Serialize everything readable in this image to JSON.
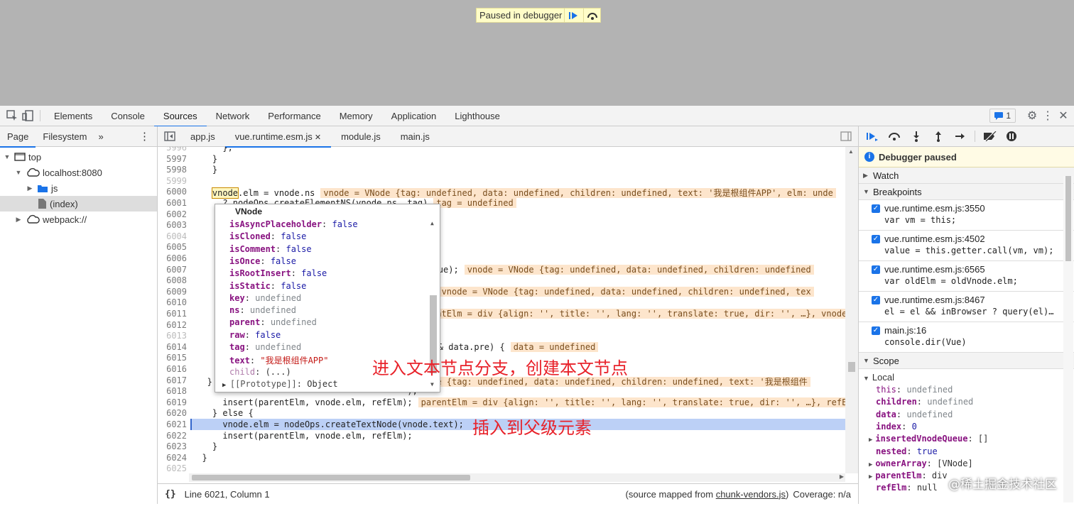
{
  "banner": {
    "text": "Paused in debugger"
  },
  "toolbar": {
    "tabs": [
      "Elements",
      "Console",
      "Sources",
      "Network",
      "Performance",
      "Memory",
      "Application",
      "Lighthouse"
    ],
    "active_tab": "Sources",
    "issues_count": "1"
  },
  "navigator": {
    "tabs": [
      "Page",
      "Filesystem"
    ],
    "tree": [
      {
        "label": "top",
        "depth": 0,
        "arrow": "▼",
        "icon": "frame-icon"
      },
      {
        "label": "localhost:8080",
        "depth": 1,
        "arrow": "▼",
        "icon": "cloud-icon"
      },
      {
        "label": "js",
        "depth": 2,
        "arrow": "▶",
        "icon": "folder-icon"
      },
      {
        "label": "(index)",
        "depth": 2,
        "arrow": "",
        "icon": "file-icon"
      },
      {
        "label": "webpack://",
        "depth": 1,
        "arrow": "▶",
        "icon": "cloud-icon"
      }
    ]
  },
  "editor": {
    "file_tabs": [
      "app.js",
      "vue.runtime.esm.js",
      "module.js",
      "main.js"
    ],
    "active_file": "vue.runtime.esm.js",
    "lines": [
      {
        "n": "5996",
        "dim": true,
        "code": "      },"
      },
      {
        "n": "5997",
        "dim": false,
        "code": "    }"
      },
      {
        "n": "5998",
        "dim": false,
        "code": "    }"
      },
      {
        "n": "5999",
        "dim": true,
        "code": ""
      },
      {
        "n": "6000",
        "dim": false,
        "code": "    vnode.elm = vnode.ns",
        "inline": "vnode = VNode {tag: undefined, data: undefined, children: undefined, text: '我是根组件APP', elm: unde"
      },
      {
        "n": "6001",
        "dim": false,
        "code": "      ? nodeOps.createElementNS(vnode.ns, tag)",
        "inline": "tag = undefined"
      },
      {
        "n": "6002",
        "dim": false,
        "code": ""
      },
      {
        "n": "6003",
        "dim": false,
        "code": ""
      },
      {
        "n": "6004",
        "dim": true,
        "code": ""
      },
      {
        "n": "6005",
        "dim": false,
        "code": ""
      },
      {
        "n": "6006",
        "dim": false,
        "code": ""
      },
      {
        "n": "6007",
        "dim": false,
        "code": "                                          odeQueue);",
        "inline": "vnode = VNode {tag: undefined, data: undefined, children: undefined"
      },
      {
        "n": "6008",
        "dim": false,
        "code": ""
      },
      {
        "n": "6009",
        "dim": false,
        "code": "                                          eue);",
        "inline": "vnode = VNode {tag: undefined, data: undefined, children: undefined, tex"
      },
      {
        "n": "6010",
        "dim": false,
        "code": ""
      },
      {
        "n": "6011",
        "dim": false,
        "code": "                                          ",
        "inline": "parentElm = div {align: '', title: '', lang: '', translate: true, dir: '', …}, vnode"
      },
      {
        "n": "6012",
        "dim": false,
        "code": ""
      },
      {
        "n": "6013",
        "dim": true,
        "code": ""
      },
      {
        "n": "6014",
        "dim": false,
        "code": "                                          data && data.pre) {",
        "inline": "data = undefined"
      },
      {
        "n": "6015",
        "dim": false,
        "code": ""
      },
      {
        "n": "6016",
        "dim": false,
        "code": ""
      },
      {
        "n": "6017",
        "dim": false,
        "code": "   }                                      ",
        "inline": "VNode {tag: undefined, data: undefined, children: undefined, text: '我是根组件"
      },
      {
        "n": "6018",
        "dim": false,
        "code": "                                          );"
      },
      {
        "n": "6019",
        "dim": false,
        "code": "      insert(parentElm, vnode.elm, refElm);",
        "inline": "parentElm = div {align: '', title: '', lang: '', translate: true, dir: '', …}, refElm"
      },
      {
        "n": "6020",
        "dim": false,
        "code": "    } else {"
      },
      {
        "n": "6021",
        "dim": false,
        "code": "      vnode.elm = nodeOps.createTextNode(vnode.text);"
      },
      {
        "n": "6022",
        "dim": false,
        "code": "      insert(parentElm, vnode.elm, refElm);"
      },
      {
        "n": "6023",
        "dim": false,
        "code": "    }"
      },
      {
        "n": "6024",
        "dim": false,
        "code": "  }"
      },
      {
        "n": "6025",
        "dim": true,
        "code": ""
      }
    ],
    "status": {
      "position": "Line 6021, Column 1",
      "source_prefix": "(source mapped from ",
      "source_link": "chunk-vendors.js",
      "source_suffix": ")",
      "coverage": "Coverage: n/a"
    }
  },
  "popover": {
    "title": "VNode",
    "props": [
      {
        "key": "isAsyncPlaceholder",
        "value": "false",
        "kind": "bo"
      },
      {
        "key": "isCloned",
        "value": "false",
        "kind": "bo"
      },
      {
        "key": "isComment",
        "value": "false",
        "kind": "bo"
      },
      {
        "key": "isOnce",
        "value": "false",
        "kind": "bo"
      },
      {
        "key": "isRootInsert",
        "value": "false",
        "kind": "bo"
      },
      {
        "key": "isStatic",
        "value": "false",
        "kind": "bo"
      },
      {
        "key": "key",
        "value": "undefined",
        "kind": "un"
      },
      {
        "key": "ns",
        "value": "undefined",
        "kind": "un"
      },
      {
        "key": "parent",
        "value": "undefined",
        "kind": "un"
      },
      {
        "key": "raw",
        "value": "false",
        "kind": "bo"
      },
      {
        "key": "tag",
        "value": "undefined",
        "kind": "un"
      },
      {
        "key": "text",
        "value": "\"我是根组件APP\"",
        "kind": "st"
      },
      {
        "key": "child",
        "value": "(...)",
        "kind": "dim"
      },
      {
        "key": "[[Prototype]]",
        "value": "Object",
        "kind": "proto"
      }
    ]
  },
  "annotations": {
    "a1": "进入文本节点分支，创建本文节点",
    "a2": "插入到父级元素"
  },
  "debugger": {
    "paused_label": "Debugger paused",
    "watch_label": "Watch",
    "breakpoints_label": "Breakpoints",
    "breakpoints": [
      {
        "file": "vue.runtime.esm.js:3550",
        "code": "var vm = this;"
      },
      {
        "file": "vue.runtime.esm.js:4502",
        "code": "value = this.getter.call(vm, vm);"
      },
      {
        "file": "vue.runtime.esm.js:6565",
        "code": "var oldElm = oldVnode.elm;"
      },
      {
        "file": "vue.runtime.esm.js:8467",
        "code": "el = el && inBrowser ? query(el)…"
      },
      {
        "file": "main.js:16",
        "code": "console.dir(Vue)"
      }
    ],
    "scope_label": "Scope",
    "local_label": "Local",
    "scope": [
      {
        "key": "this",
        "value": "undefined",
        "bold": false,
        "arrow": false
      },
      {
        "key": "children",
        "value": "undefined",
        "bold": true,
        "arrow": false
      },
      {
        "key": "data",
        "value": "undefined",
        "bold": true,
        "arrow": false
      },
      {
        "key": "index",
        "value": "0",
        "bold": true,
        "arrow": false,
        "num": true
      },
      {
        "key": "insertedVnodeQueue",
        "value": "[]",
        "bold": true,
        "arrow": true
      },
      {
        "key": "nested",
        "value": "true",
        "bold": true,
        "arrow": false,
        "num": true
      },
      {
        "key": "ownerArray",
        "value": "[VNode]",
        "bold": true,
        "arrow": true
      },
      {
        "key": "parentElm",
        "value": "div",
        "bold": true,
        "arrow": true
      },
      {
        "key": "refElm",
        "value": "null",
        "bold": true,
        "arrow": false
      }
    ]
  },
  "watermark": "@稀土掘金技术社区"
}
